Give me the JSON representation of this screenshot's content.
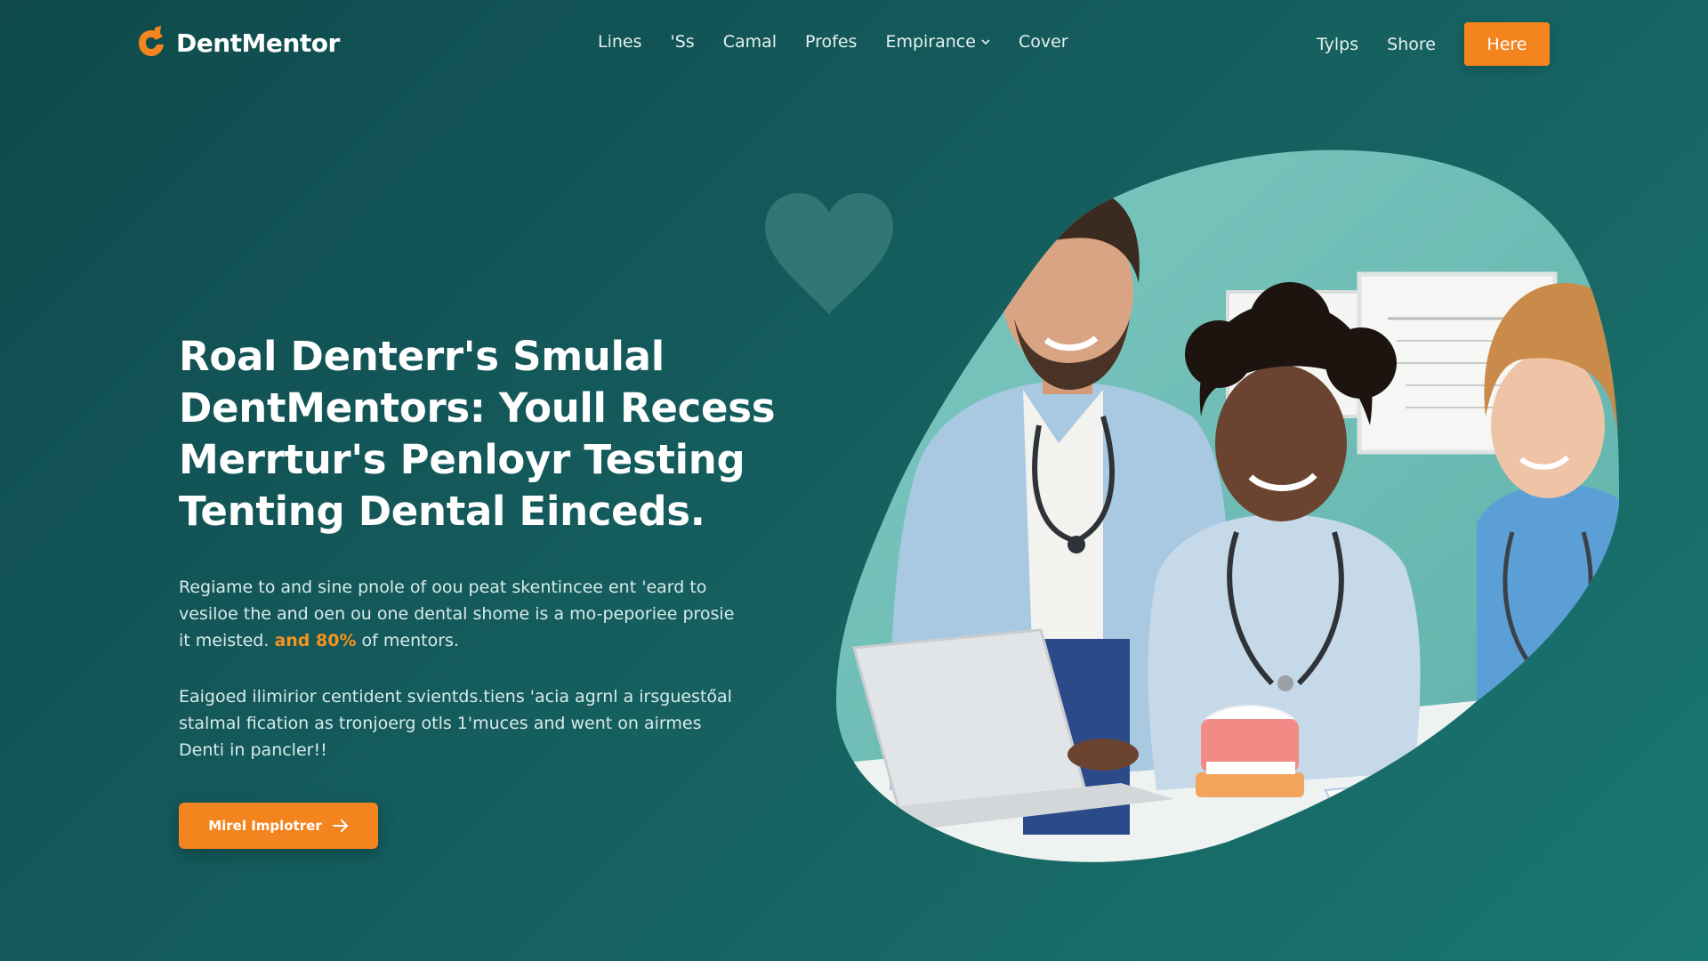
{
  "brand": {
    "name": "DentMentor"
  },
  "nav": {
    "items": [
      "Lines",
      "'Ss",
      "Camal",
      "Profes",
      "Empirance",
      "Cover"
    ],
    "dropdown_item_index": 4
  },
  "nav_right": {
    "links": [
      "Tylps",
      "Shore"
    ],
    "cta_label": "Here"
  },
  "hero": {
    "title": "Roal Denterr's Smulal DentMentors: Youll Recess Merrtur's Penloyr Testing Tenting Dental Einceds.",
    "paragraph1_text": "Regiame to and sine pnole of oou peat skentincee ent 'eard to vesiloe the and oen ou one dental shome is a mo-peporiee prosie it meisted.",
    "paragraph1_highlight": "and 80%",
    "paragraph1_suffix": "of mentors.",
    "paragraph2": "Eaigoed ilimirior centident svientds.tiens 'acia agrnl a irsguestőal stalmal fication as tronjoerg otls 1'muces and went on airmes Denti in pancler!!",
    "cta_label": "Mirel Implotrer"
  },
  "colors": {
    "background": "#145a5b",
    "accent": "#f3841e",
    "text_primary": "#ffffff",
    "text_secondary": "#d8ebe9",
    "blob_back": "#72c0b9"
  },
  "icons": {
    "logo": "tooth-logo-icon",
    "dropdown": "chevron-down-icon",
    "cta_arrow": "arrow-right-icon",
    "decor": "heart-icon"
  }
}
